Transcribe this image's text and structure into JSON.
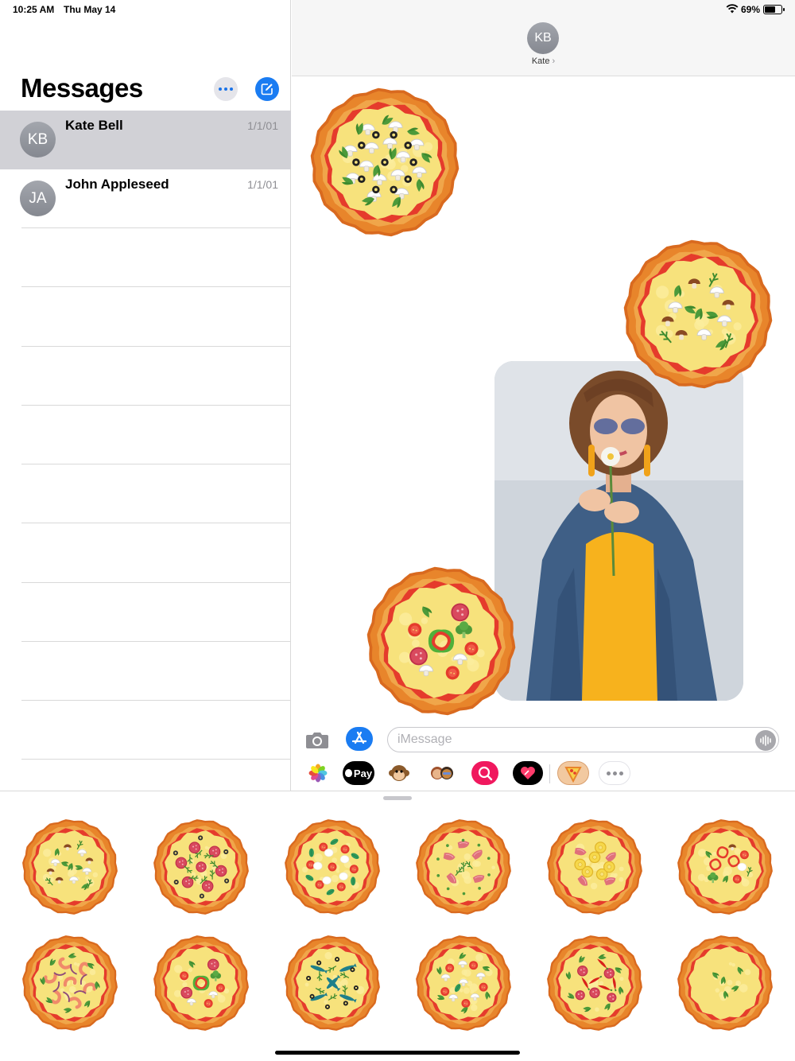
{
  "status_bar": {
    "time": "10:25 AM",
    "date": "Thu May 14",
    "battery_percent": "69%",
    "battery_level": 0.69,
    "icons": [
      "wifi-icon",
      "battery-icon"
    ]
  },
  "sidebar": {
    "title": "Messages",
    "conversations": [
      {
        "initials": "KB",
        "name": "Kate Bell",
        "date": "1/1/01",
        "selected": true
      },
      {
        "initials": "JA",
        "name": "John Appleseed",
        "date": "1/1/01",
        "selected": false
      }
    ]
  },
  "chat_header": {
    "initials": "KB",
    "name": "Kate",
    "chevron": "›"
  },
  "input": {
    "placeholder": "iMessage"
  },
  "app_strip": {
    "apps": [
      "photos-app-icon",
      "apple-pay-app-icon",
      "animoji-app-icon",
      "memoji-app-icon",
      "search-images-app-icon",
      "digital-touch-app-icon",
      "pizza-stickers-app-icon",
      "more-apps-icon"
    ],
    "apple_pay_label": "Pay"
  },
  "colors": {
    "accent": "#1a7cf2",
    "selected_row": "#d1d1d6",
    "crust": "#e8852b",
    "cheese": "#f7e27c",
    "tomato": "#e53b2c"
  },
  "stickers": [
    "mushroom-herb-pizza",
    "salami-pizza",
    "tomato-mozzarella-basil-pizza",
    "ham-rosemary-pizza",
    "ham-pineapple-pizza",
    "pepper-tomato-broccoli-pizza",
    "shrimp-onion-pizza",
    "pepper-salami-pizza",
    "anchovy-pizza",
    "mushroom-tomato-pizza",
    "salami-chili-pizza",
    "cheese-herb-pizza"
  ]
}
